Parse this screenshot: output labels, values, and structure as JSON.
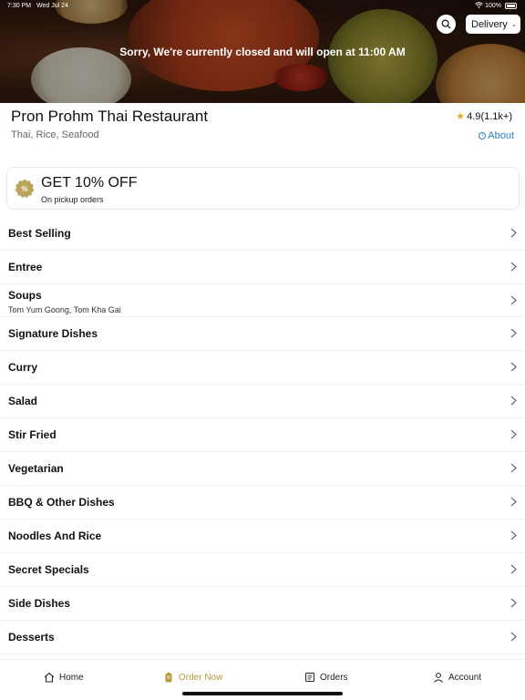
{
  "status_bar": {
    "time": "7:30 PM",
    "date": "Wed Jul 24",
    "battery": "100%"
  },
  "header": {
    "mode_label": "Delivery",
    "closed_message": "Sorry, We're currently closed and will open at 11:00 AM"
  },
  "restaurant": {
    "name": "Pron Prohm Thai Restaurant",
    "tags": "Thai, Rice, Seafood",
    "rating": "4.9(1.1k+)",
    "about_label": "About"
  },
  "promo": {
    "title": "GET 10% OFF",
    "subtitle": "On pickup orders",
    "badge_color": "#b9a45a"
  },
  "menu": {
    "items": [
      {
        "label": "Best Selling",
        "desc": ""
      },
      {
        "label": "Entree",
        "desc": ""
      },
      {
        "label": "Soups",
        "desc": "Tom Yum Goong, Tom Kha Gai"
      },
      {
        "label": "Signature Dishes",
        "desc": ""
      },
      {
        "label": "Curry",
        "desc": ""
      },
      {
        "label": "Salad",
        "desc": ""
      },
      {
        "label": "Stir Fried",
        "desc": ""
      },
      {
        "label": "Vegetarian",
        "desc": ""
      },
      {
        "label": "BBQ & Other Dishes",
        "desc": ""
      },
      {
        "label": "Noodles And Rice",
        "desc": ""
      },
      {
        "label": "Secret Specials",
        "desc": ""
      },
      {
        "label": "Side Dishes",
        "desc": ""
      },
      {
        "label": "Desserts",
        "desc": ""
      }
    ]
  },
  "tabbar": {
    "home": "Home",
    "order_now": "Order Now",
    "orders": "Orders",
    "account": "Account",
    "active_color": "#b59a3b"
  }
}
